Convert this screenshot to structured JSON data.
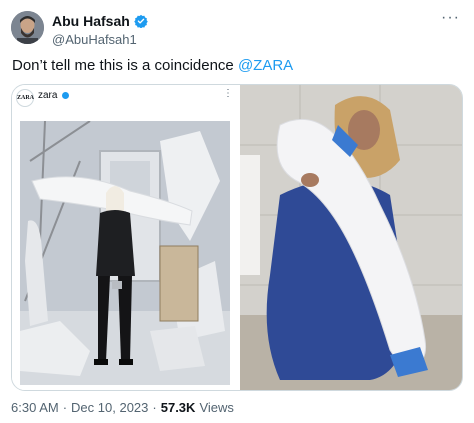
{
  "author": {
    "name": "Abu Hafsah",
    "handle": "@AbuHafsah1"
  },
  "more_label": "···",
  "tweet": {
    "text_prefix": "Don’t tell me this is a coincidence ",
    "mention": "@ZARA"
  },
  "embedded": {
    "logo_text": "ZARA",
    "account_name": "zara",
    "more_label": "⋮"
  },
  "meta": {
    "time": "6:30 AM",
    "sep1": "·",
    "date": "Dec 10, 2023",
    "sep2": "·",
    "views_count": "57.3K",
    "views_label": "Views"
  },
  "colors": {
    "accent": "#1d9bf0",
    "muted": "#536471",
    "text": "#0f1419"
  }
}
